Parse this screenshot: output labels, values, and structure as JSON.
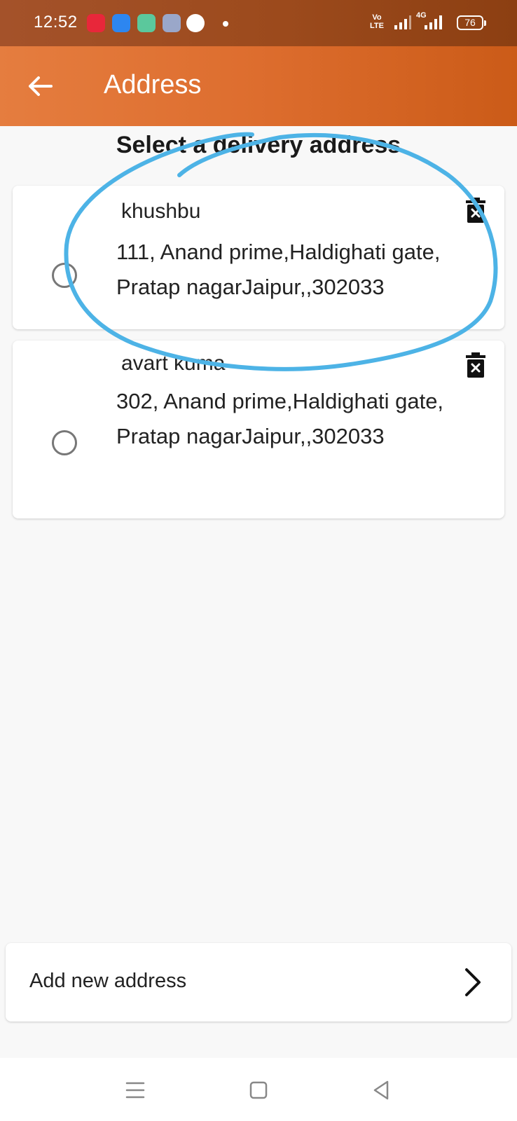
{
  "status_bar": {
    "time": "12:52",
    "volte_line1": "Vo",
    "volte_line2": "LTE",
    "network": "4G",
    "battery": "76",
    "apps": [
      {
        "icon": "app-red-icon",
        "color": "#e8273a"
      },
      {
        "icon": "app-blue-icon",
        "color": "#2d86f0"
      },
      {
        "icon": "app-green-icon",
        "color": "#5bc89c"
      },
      {
        "icon": "settings-icon",
        "color": "#9aa7c9"
      },
      {
        "icon": "phone-icon",
        "color": "#ffffff"
      }
    ]
  },
  "app_bar": {
    "title": "Address",
    "back_icon": "arrow-left-icon"
  },
  "heading": "Select a delivery address",
  "addresses": [
    {
      "name": "khushbu",
      "address": "111, Anand prime,Haldighati gate, Pratap nagarJaipur,,302033",
      "selected": false,
      "delete_icon": "delete-forever-icon"
    },
    {
      "name": "avart kuma",
      "address": "302, Anand prime,Haldighati gate, Pratap nagarJaipur,,302033",
      "selected": false,
      "delete_icon": "delete-forever-icon"
    }
  ],
  "add_address": {
    "label": "Add new address",
    "icon": "chevron-right-icon"
  },
  "nav_bar": {
    "icons": [
      "menu-icon",
      "home-square-icon",
      "back-triangle-icon"
    ]
  },
  "colors": {
    "app_bar": "#dd6d2e",
    "status_bar": "#9c4a1c",
    "annotation_stroke": "#4db3e6",
    "background": "#f8f8f8"
  }
}
